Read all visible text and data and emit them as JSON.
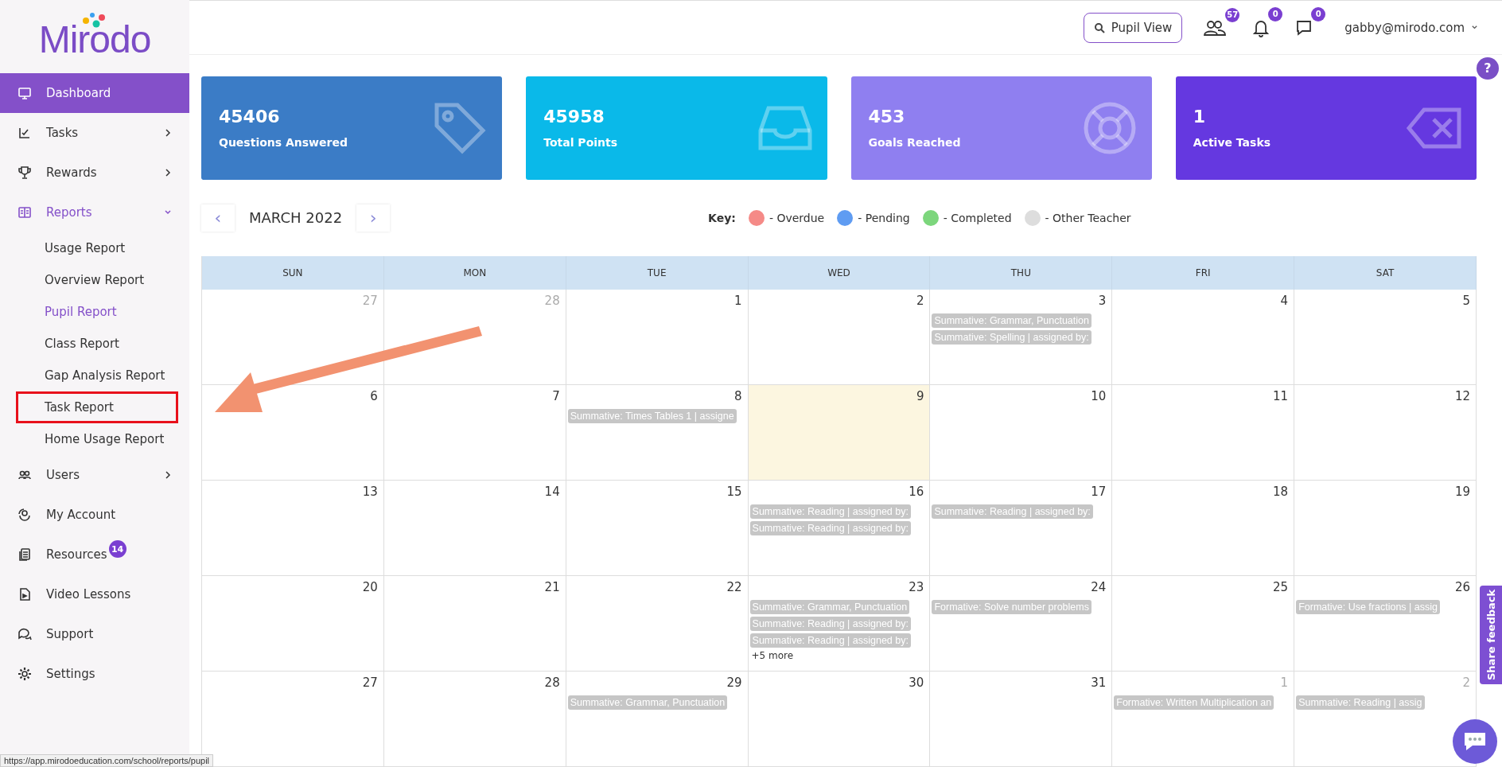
{
  "logo": {
    "text": "Mirodo"
  },
  "sidebar": {
    "items": [
      {
        "label": "Dashboard",
        "selected": true,
        "expandable": false,
        "expanded": false
      },
      {
        "label": "Tasks",
        "selected": false,
        "expandable": true,
        "expanded": false
      },
      {
        "label": "Rewards",
        "selected": false,
        "expandable": true,
        "expanded": false
      },
      {
        "label": "Reports",
        "selected": false,
        "expandable": true,
        "expanded": true,
        "children": [
          {
            "label": "Usage Report",
            "selected": false,
            "highlighted": false
          },
          {
            "label": "Overview Report",
            "selected": false,
            "highlighted": false
          },
          {
            "label": "Pupil Report",
            "selected": true,
            "highlighted": false
          },
          {
            "label": "Class Report",
            "selected": false,
            "highlighted": false
          },
          {
            "label": "Gap Analysis Report",
            "selected": false,
            "highlighted": false
          },
          {
            "label": "Task Report",
            "selected": false,
            "highlighted": true
          },
          {
            "label": "Home Usage Report",
            "selected": false,
            "highlighted": false
          }
        ]
      },
      {
        "label": "Users",
        "selected": false,
        "expandable": true,
        "expanded": false
      },
      {
        "label": "My Account",
        "selected": false,
        "expandable": false,
        "expanded": false
      },
      {
        "label": "Resources",
        "selected": false,
        "expandable": false,
        "expanded": false,
        "badge": "14"
      },
      {
        "label": "Video Lessons",
        "selected": false,
        "expandable": false,
        "expanded": false
      },
      {
        "label": "Support",
        "selected": false,
        "expandable": false,
        "expanded": false
      },
      {
        "label": "Settings",
        "selected": false,
        "expandable": false,
        "expanded": false
      }
    ]
  },
  "topbar": {
    "pupil_view": "Pupil View",
    "pupils_badge": "57",
    "notifications_badge": "0",
    "messages_badge": "0",
    "user": "gabby@mirodo.com",
    "help": "?"
  },
  "stats": [
    {
      "value": "45406",
      "label": "Questions Answered",
      "color": "#3b7cc6"
    },
    {
      "value": "45958",
      "label": "Total Points",
      "color": "#0ab9e9"
    },
    {
      "value": "453",
      "label": "Goals Reached",
      "color": "#8f7ff0"
    },
    {
      "value": "1",
      "label": "Active Tasks",
      "color": "#6538e0"
    }
  ],
  "calendar": {
    "month": "MARCH 2022",
    "prev": "‹",
    "next": "›",
    "key_label": "Key:",
    "key": [
      {
        "label": "- Overdue",
        "color": "#f58a87"
      },
      {
        "label": "- Pending",
        "color": "#5f9cf2"
      },
      {
        "label": "- Completed",
        "color": "#7cd67c"
      },
      {
        "label": "- Other Teacher",
        "color": "#dddddd"
      }
    ],
    "weekdays": [
      "SUN",
      "MON",
      "TUE",
      "WED",
      "THU",
      "FRI",
      "SAT"
    ],
    "weeks": [
      [
        {
          "day": "27",
          "muted": true,
          "today": false
        },
        {
          "day": "28",
          "muted": true,
          "today": false
        },
        {
          "day": "1",
          "muted": false,
          "today": false
        },
        {
          "day": "2",
          "muted": false,
          "today": false
        },
        {
          "day": "3",
          "muted": false,
          "today": false,
          "events": [
            "Summative: Grammar, Punctuation",
            "Summative: Spelling | assigned by:"
          ]
        },
        {
          "day": "4",
          "muted": false,
          "today": false
        },
        {
          "day": "5",
          "muted": false,
          "today": false
        }
      ],
      [
        {
          "day": "6",
          "muted": false,
          "today": false
        },
        {
          "day": "7",
          "muted": false,
          "today": false
        },
        {
          "day": "8",
          "muted": false,
          "today": false,
          "events": [
            "Summative: Times Tables 1 | assigne"
          ]
        },
        {
          "day": "9",
          "muted": false,
          "today": true
        },
        {
          "day": "10",
          "muted": false,
          "today": false
        },
        {
          "day": "11",
          "muted": false,
          "today": false
        },
        {
          "day": "12",
          "muted": false,
          "today": false
        }
      ],
      [
        {
          "day": "13",
          "muted": false,
          "today": false
        },
        {
          "day": "14",
          "muted": false,
          "today": false
        },
        {
          "day": "15",
          "muted": false,
          "today": false
        },
        {
          "day": "16",
          "muted": false,
          "today": false,
          "events": [
            "Summative: Reading | assigned by:",
            "Summative: Reading | assigned by:"
          ]
        },
        {
          "day": "17",
          "muted": false,
          "today": false,
          "events": [
            "Summative: Reading | assigned by:"
          ]
        },
        {
          "day": "18",
          "muted": false,
          "today": false
        },
        {
          "day": "19",
          "muted": false,
          "today": false
        }
      ],
      [
        {
          "day": "20",
          "muted": false,
          "today": false
        },
        {
          "day": "21",
          "muted": false,
          "today": false
        },
        {
          "day": "22",
          "muted": false,
          "today": false
        },
        {
          "day": "23",
          "muted": false,
          "today": false,
          "events": [
            "Summative: Grammar, Punctuation",
            "Summative: Reading | assigned by:",
            "Summative: Reading | assigned by:"
          ],
          "more": "+5 more"
        },
        {
          "day": "24",
          "muted": false,
          "today": false,
          "events": [
            "Formative: Solve number problems"
          ]
        },
        {
          "day": "25",
          "muted": false,
          "today": false
        },
        {
          "day": "26",
          "muted": false,
          "today": false,
          "events": [
            "Formative: Use fractions | assig"
          ]
        }
      ],
      [
        {
          "day": "27",
          "muted": false,
          "today": false
        },
        {
          "day": "28",
          "muted": false,
          "today": false
        },
        {
          "day": "29",
          "muted": false,
          "today": false,
          "events": [
            "Summative: Grammar, Punctuation"
          ]
        },
        {
          "day": "30",
          "muted": false,
          "today": false
        },
        {
          "day": "31",
          "muted": false,
          "today": false
        },
        {
          "day": "1",
          "muted": true,
          "today": false,
          "events": [
            "Formative: Written Multiplication an"
          ]
        },
        {
          "day": "2",
          "muted": true,
          "today": false,
          "events": [
            "Summative: Reading | assig"
          ]
        }
      ]
    ]
  },
  "feedback_tab": "Share feedback",
  "status_bar": "https://app.mirodoeducation.com/school/reports/pupil"
}
